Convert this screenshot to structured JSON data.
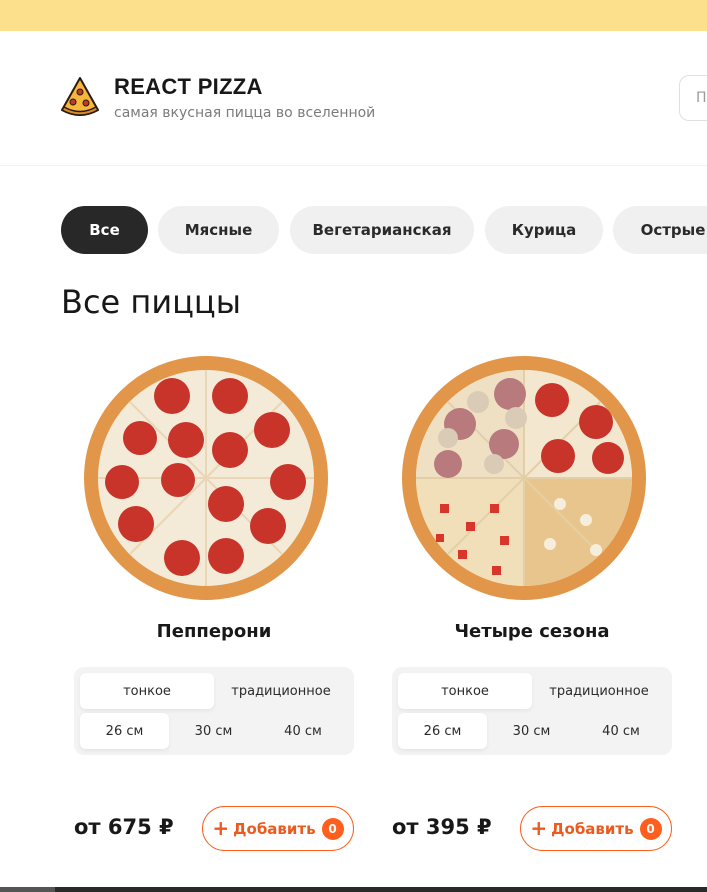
{
  "brand": {
    "title": "REACT PIZZA",
    "subtitle": "самая вкусная пицца во вселенной"
  },
  "search": {
    "placeholder": "П"
  },
  "categories": [
    {
      "label": "Все",
      "active": true
    },
    {
      "label": "Мясные",
      "active": false
    },
    {
      "label": "Вегетарианская",
      "active": false
    },
    {
      "label": "Курица",
      "active": false
    },
    {
      "label": "Острые",
      "active": false
    }
  ],
  "page_title": "Все пиццы",
  "pizzas": [
    {
      "name": "Пепперони",
      "types": [
        "тонкое",
        "традиционное"
      ],
      "active_type": 0,
      "sizes": [
        "26 см",
        "30 см",
        "40 см"
      ],
      "active_size": 0,
      "price": "от 675 ₽",
      "add_label": "Добавить",
      "count": "0"
    },
    {
      "name": "Четыре сезона",
      "types": [
        "тонкое",
        "традиционное"
      ],
      "active_type": 0,
      "sizes": [
        "26 см",
        "30 см",
        "40 см"
      ],
      "active_size": 0,
      "price": "от 395 ₽",
      "add_label": "Добавить",
      "count": "0"
    }
  ],
  "colors": {
    "accent": "#fe5f1e",
    "active_category": "#282828",
    "top_stripe": "#fde08c"
  },
  "icons": {
    "logo": "pizza-slice-icon",
    "add": "plus-icon"
  }
}
